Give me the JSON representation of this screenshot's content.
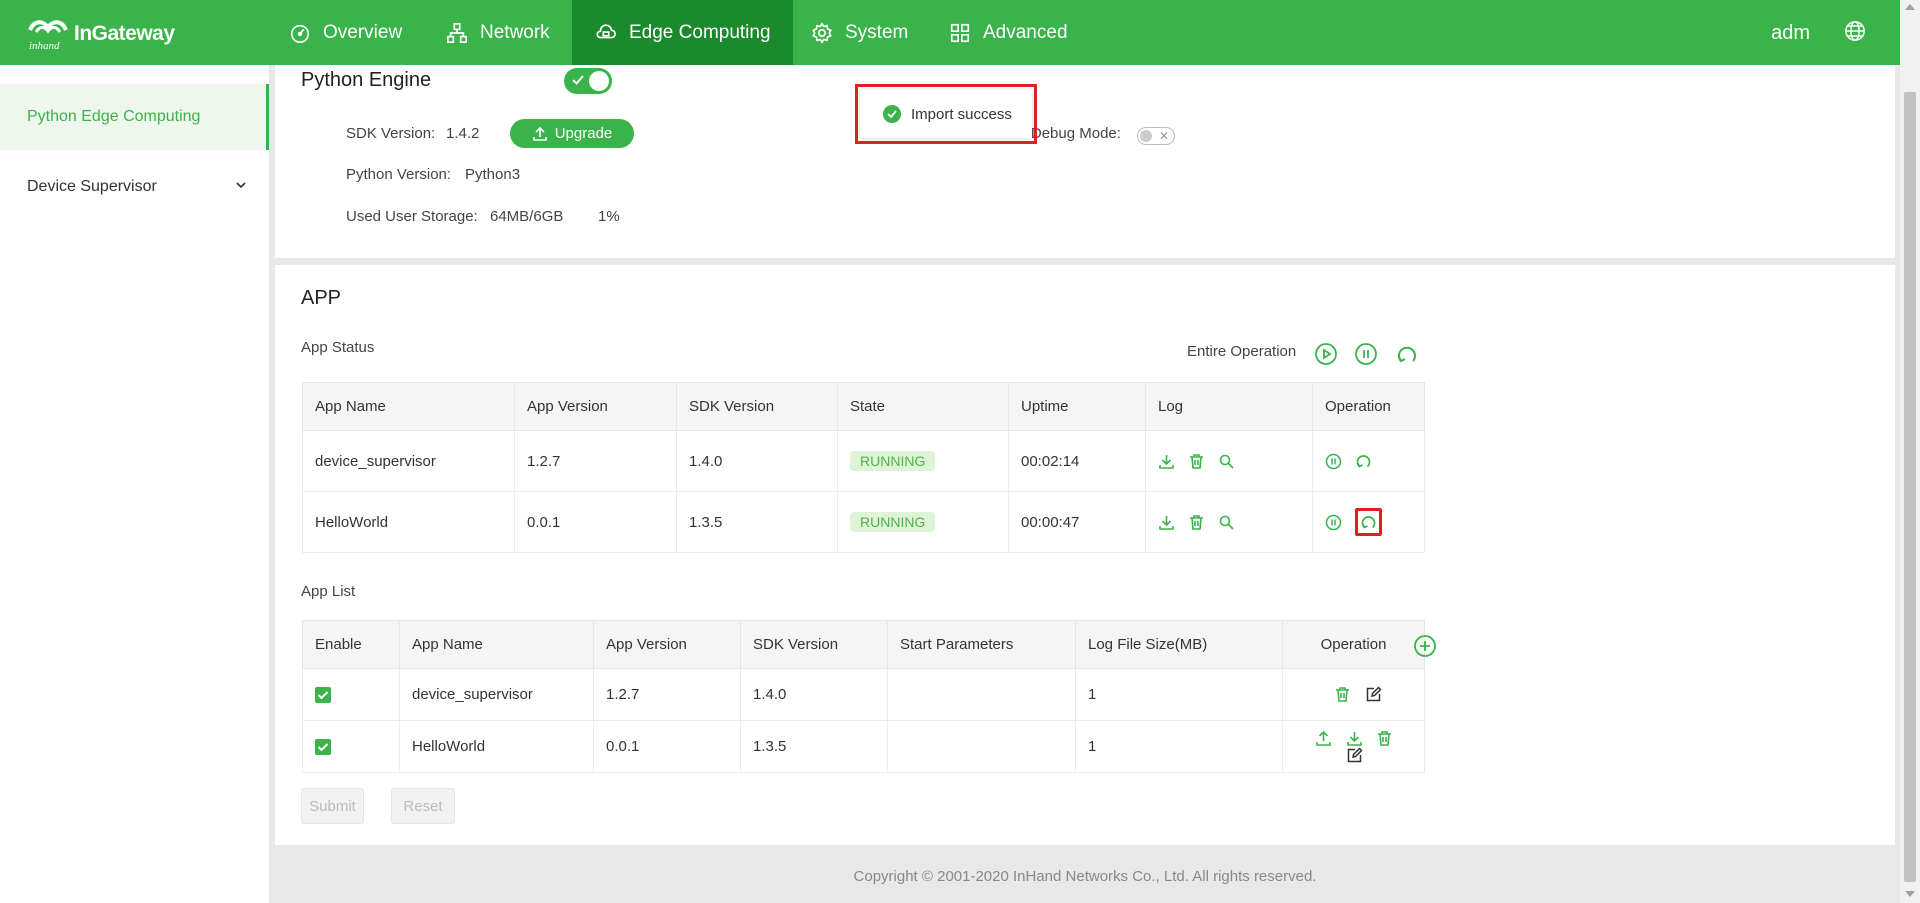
{
  "brand": {
    "name": "InGateway",
    "mark_text": "inhand"
  },
  "nav": {
    "items": [
      {
        "label": "Overview",
        "icon": "dashboard-icon"
      },
      {
        "label": "Network",
        "icon": "network-icon"
      },
      {
        "label": "Edge Computing",
        "icon": "cloud-icon",
        "active": true
      },
      {
        "label": "System",
        "icon": "gear-icon"
      },
      {
        "label": "Advanced",
        "icon": "grid-icon"
      }
    ],
    "user": "adm"
  },
  "sidebar": {
    "items": [
      {
        "label": "Python Edge Computing",
        "active": true
      },
      {
        "label": "Device Supervisor",
        "expandable": true
      }
    ]
  },
  "engine": {
    "title": "Python Engine",
    "enabled": true,
    "sdk_version_label": "SDK Version:",
    "sdk_version": "1.4.2",
    "upgrade_label": "Upgrade",
    "python_version_label": "Python Version:",
    "python_version": "Python3",
    "storage_label": "Used User Storage:",
    "storage_value": "64MB/6GB",
    "storage_percent": "1%",
    "debug_label": "Enable Debug Mode:",
    "debug_enabled": false
  },
  "toast": {
    "message": "Import success"
  },
  "app": {
    "title": "APP",
    "status_title": "App Status",
    "entire_operation_label": "Entire Operation",
    "status_columns": [
      "App Name",
      "App Version",
      "SDK Version",
      "State",
      "Uptime",
      "Log",
      "Operation"
    ],
    "status_rows": [
      {
        "name": "device_supervisor",
        "app_version": "1.2.7",
        "sdk_version": "1.4.0",
        "state": "RUNNING",
        "uptime": "00:02:14"
      },
      {
        "name": "HelloWorld",
        "app_version": "0.0.1",
        "sdk_version": "1.3.5",
        "state": "RUNNING",
        "uptime": "00:00:47"
      }
    ],
    "list_title": "App List",
    "list_columns": [
      "Enable",
      "App Name",
      "App Version",
      "SDK Version",
      "Start Parameters",
      "Log File Size(MB)",
      "Operation"
    ],
    "list_rows": [
      {
        "enabled": true,
        "name": "device_supervisor",
        "app_version": "1.2.7",
        "sdk_version": "1.4.0",
        "start_params": "",
        "log_size": "1"
      },
      {
        "enabled": true,
        "name": "HelloWorld",
        "app_version": "0.0.1",
        "sdk_version": "1.3.5",
        "start_params": "",
        "log_size": "1"
      }
    ],
    "submit_label": "Submit",
    "reset_label": "Reset"
  },
  "footer": {
    "copyright": "Copyright © 2001-2020 InHand Networks Co., Ltd. All rights reserved."
  },
  "colors": {
    "primary": "#3ab34a",
    "nav_active": "#1b8a2d",
    "highlight": "#e02020"
  }
}
